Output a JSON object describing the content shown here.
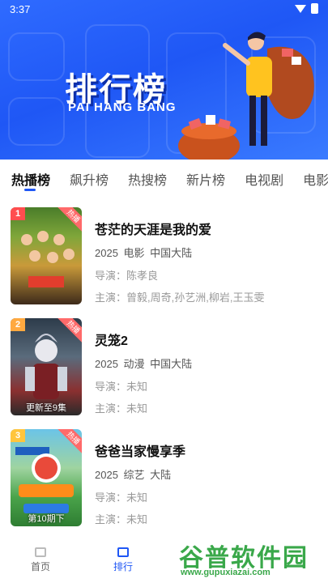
{
  "status_bar": {
    "time": "3:37"
  },
  "banner": {
    "title": "排行榜",
    "subtitle": "PAI HANG BANG"
  },
  "tabs": [
    {
      "label": "热播榜",
      "active": true
    },
    {
      "label": "飙升榜",
      "active": false
    },
    {
      "label": "热搜榜",
      "active": false
    },
    {
      "label": "新片榜",
      "active": false
    },
    {
      "label": "电视剧",
      "active": false
    },
    {
      "label": "电影",
      "active": false
    }
  ],
  "items": [
    {
      "rank": "1",
      "badge": "热播",
      "title": "苍茫的天涯是我的爱",
      "meta": "2025 电影 中国大陆",
      "director": "导演：陈孝良",
      "cast": "主演：曾毅,周奇,孙艺洲,柳岩,王玉雯",
      "rank_color": "#ff4d4f",
      "poster_label": ""
    },
    {
      "rank": "2",
      "badge": "热播",
      "title": "灵笼2",
      "meta": "2025 动漫 中国大陆",
      "director": "导演：未知",
      "cast": "主演：未知",
      "rank_color": "#ffa940",
      "poster_label": "更新至9集"
    },
    {
      "rank": "3",
      "badge": "热播",
      "title": "爸爸当家慢享季",
      "meta": "2025 综艺 大陆",
      "director": "导演：未知",
      "cast": "主演：未知",
      "rank_color": "#ffc53d",
      "poster_label": "第10期下"
    }
  ],
  "bottom_nav": [
    {
      "label": "首页",
      "icon": "home-icon",
      "active": false
    },
    {
      "label": "排行",
      "icon": "ranking-icon",
      "active": true
    }
  ],
  "watermark": {
    "text": "谷普软件园",
    "url": "www.gupuxiazai.com"
  },
  "colors": {
    "accent": "#1f57f5",
    "banner_bg": "#2f6bff"
  }
}
